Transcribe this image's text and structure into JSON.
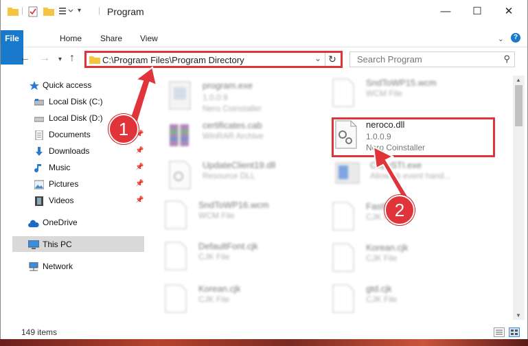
{
  "window": {
    "title": "Program",
    "controls": {
      "minimize": "—",
      "maximize": "☐",
      "close": "✕"
    }
  },
  "ribbon": {
    "tabs": [
      "File",
      "Home",
      "Share",
      "View"
    ],
    "expand_icon": "chevron-down-icon",
    "help": "?"
  },
  "address_bar": {
    "path": "C:\\Program Files\\Program Directory"
  },
  "search": {
    "placeholder": "Search Program"
  },
  "nav_pane": {
    "items": [
      {
        "label": "Quick access",
        "icon": "star-icon",
        "pinned": false
      },
      {
        "label": "Local Disk (C:)",
        "icon": "drive-icon",
        "pinned": false
      },
      {
        "label": "Local Disk (D:)",
        "icon": "drive-icon",
        "pinned": false
      },
      {
        "label": "Documents",
        "icon": "documents-icon",
        "pinned": true
      },
      {
        "label": "Downloads",
        "icon": "downloads-icon",
        "pinned": true
      },
      {
        "label": "Music",
        "icon": "music-icon",
        "pinned": true
      },
      {
        "label": "Pictures",
        "icon": "pictures-icon",
        "pinned": true
      },
      {
        "label": "Videos",
        "icon": "videos-icon",
        "pinned": true
      },
      {
        "label": "OneDrive",
        "icon": "onedrive-icon",
        "pinned": false
      },
      {
        "label": "This PC",
        "icon": "pc-icon",
        "pinned": false,
        "selected": true
      },
      {
        "label": "Network",
        "icon": "network-icon",
        "pinned": false
      }
    ]
  },
  "files": {
    "left": [
      {
        "name": "program.exe",
        "version": "1.0.0.9",
        "type": "Nero Coinstaller"
      },
      {
        "name": "certificates.cab",
        "version": "",
        "type": "WinRAR Archive"
      },
      {
        "name": "UpdateClient19.dll",
        "version": "",
        "type": "Resource DLL"
      },
      {
        "name": "SndToWP16.wcm",
        "version": "",
        "type": "WCM File"
      },
      {
        "name": "DefaultFont.cjk",
        "version": "",
        "type": "CJK File"
      },
      {
        "name": "Korean.cjk",
        "version": "",
        "type": "CJK File"
      }
    ],
    "right": [
      {
        "name": "SndToWP15.wcm",
        "version": "",
        "type": "WCM File"
      },
      {
        "name": "neroco.dll",
        "version": "1.0.0.9",
        "type": "Nero Coinstaller"
      },
      {
        "name": "CopySTI.exe",
        "version": "",
        "type": "Allow sb event hand..."
      },
      {
        "name": "FastRip.cjk",
        "version": "",
        "type": "CJK File"
      },
      {
        "name": "Korean.cjk",
        "version": "",
        "type": "CJK File"
      },
      {
        "name": "gtd.cjk",
        "version": "",
        "type": "CJK File"
      }
    ]
  },
  "status": {
    "count": "149 items"
  },
  "callouts": [
    "1",
    "2"
  ],
  "colors": {
    "accent": "#1979ca",
    "highlight": "#e0343a",
    "selected_bg": "#d9d9d9"
  }
}
